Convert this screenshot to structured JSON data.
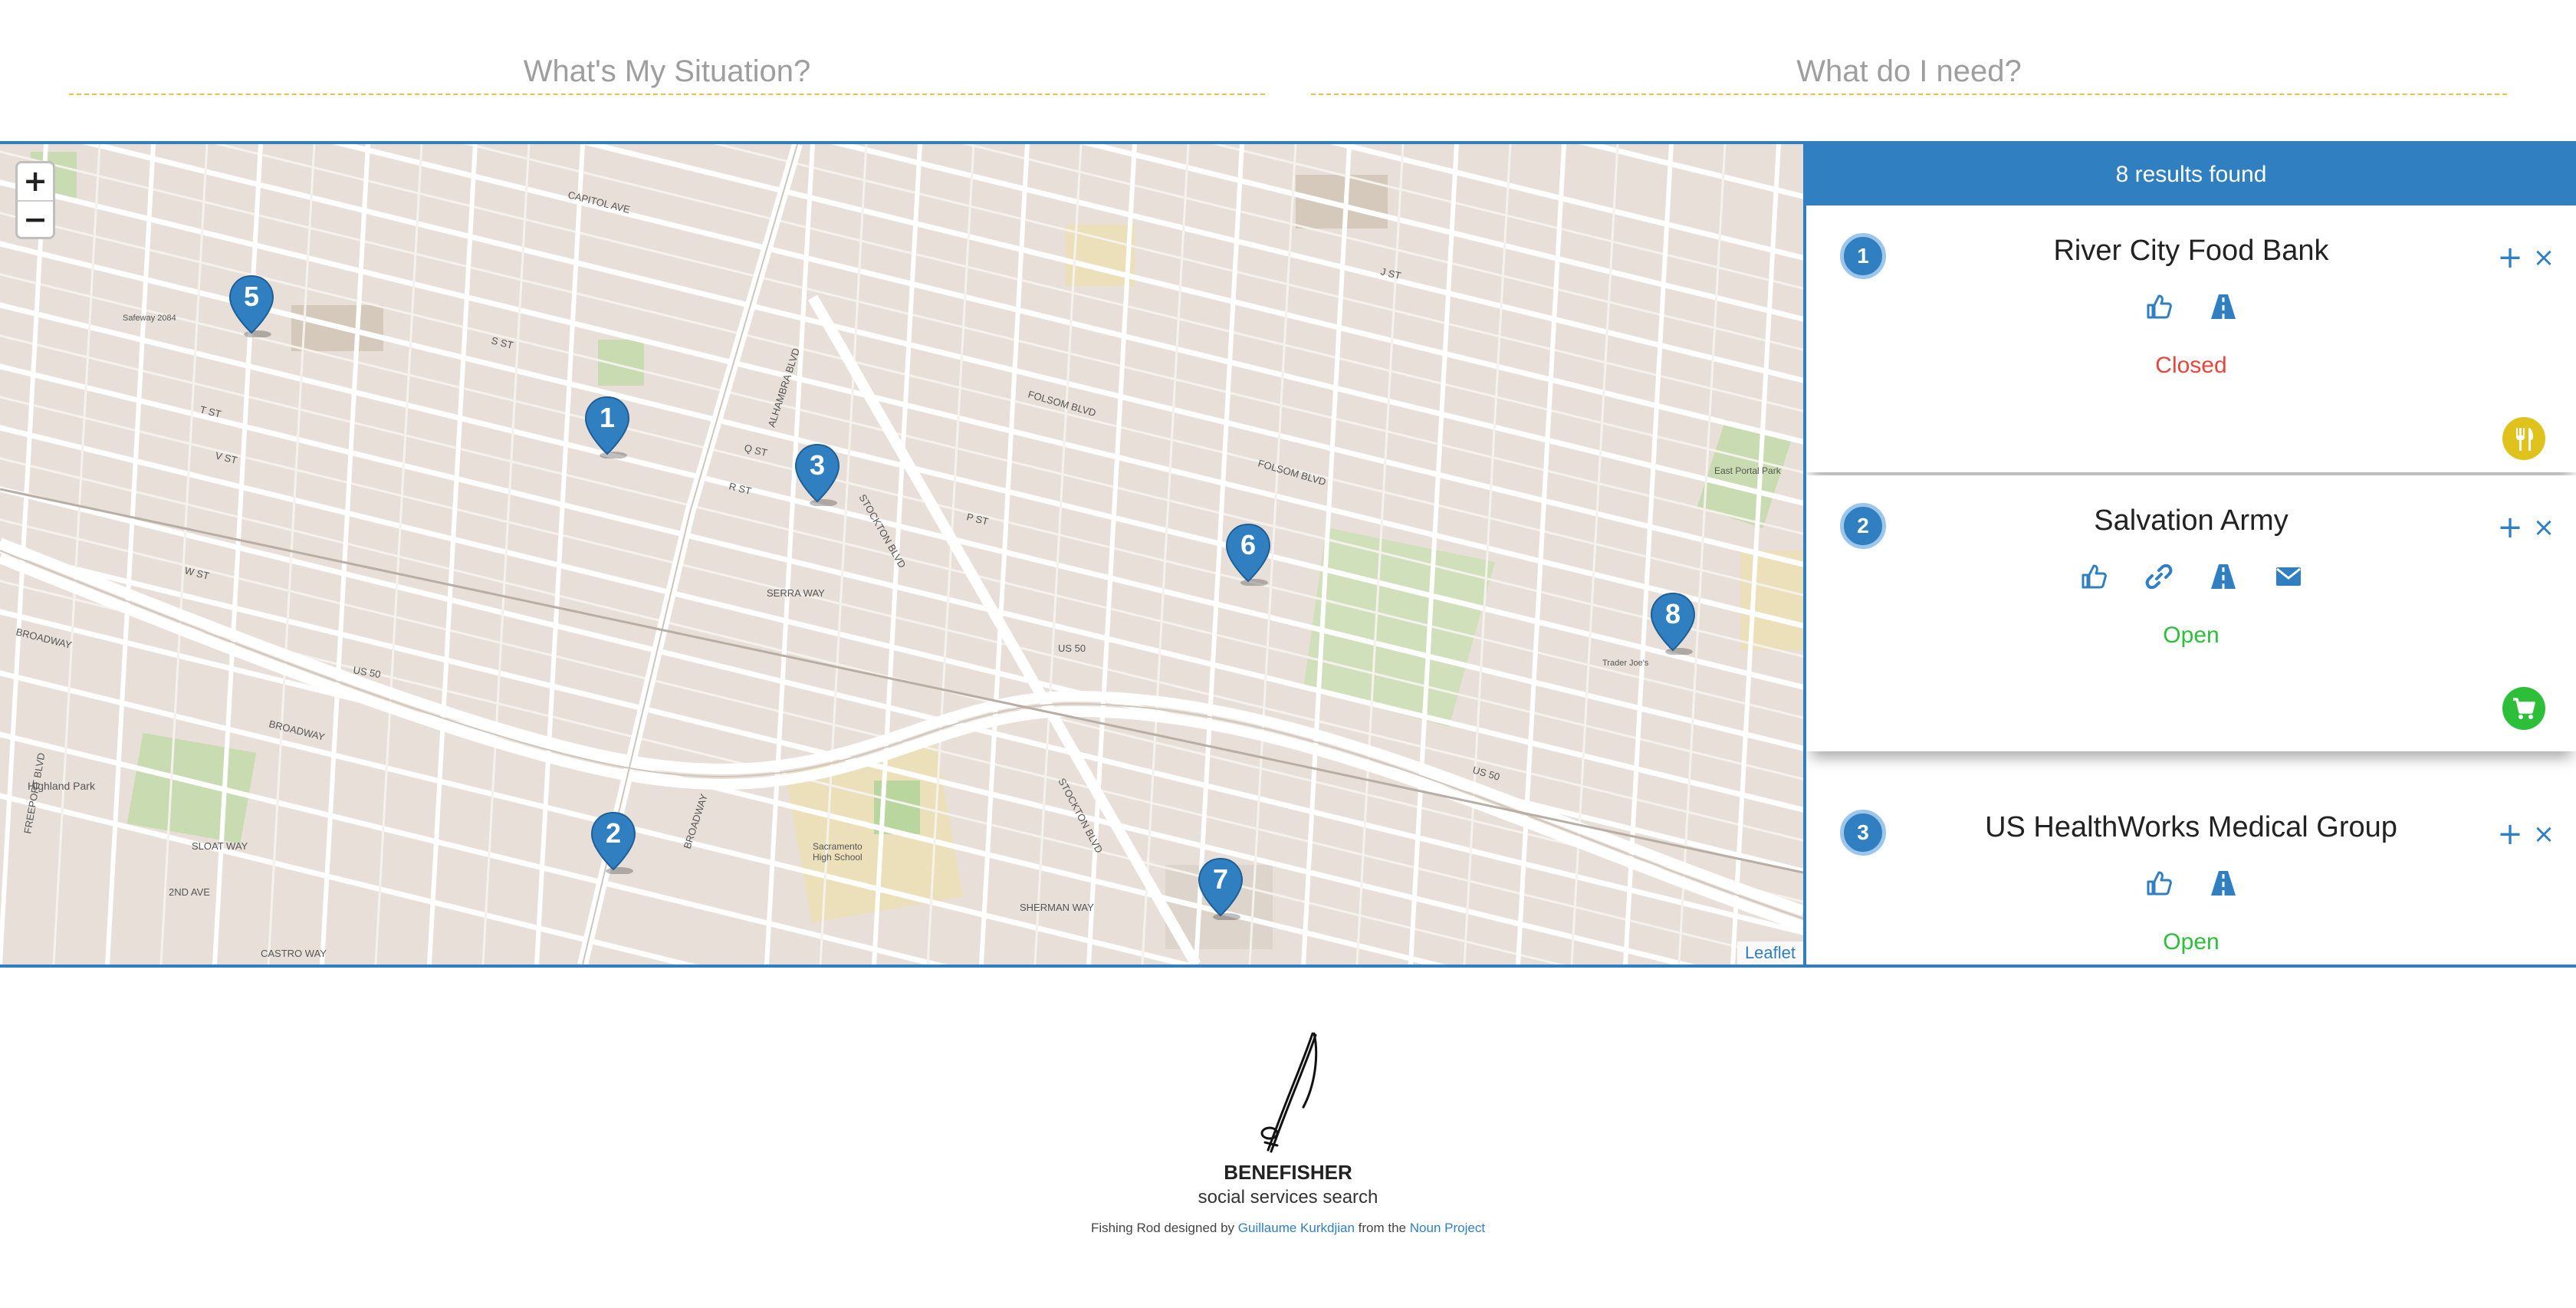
{
  "header": {
    "situation_label": "What's My Situation?",
    "need_label": "What do I need?"
  },
  "map": {
    "zoom_in_label": "+",
    "zoom_out_label": "−",
    "attribution": "Leaflet",
    "markers": [
      "1",
      "2",
      "3",
      "5",
      "6",
      "7",
      "8"
    ],
    "marker_color": "#2f7fc1",
    "street_labels": [
      "CAPITOL AVE",
      "FOLSOM BLVD",
      "STOCKTON BLVD",
      "BROADWAY",
      "US 50",
      "ALHAMBRA BLVD",
      "S ST",
      "T ST",
      "V ST",
      "W ST",
      "J ST",
      "P ST",
      "Q ST",
      "R ST",
      "SERRA WAY",
      "SHERMAN WAY",
      "2ND AVE",
      "SLOAT WAY",
      "CASTRO WAY",
      "FREEPORT BLVD",
      "Highland Park",
      "East Portal Park",
      "Sacramento High School",
      "Safeway 2084",
      "Trader Joe's"
    ]
  },
  "results": {
    "header": "8 results found",
    "header_color": "#2f7fc1",
    "items": [
      {
        "number": "1",
        "name": "River City Food Bank",
        "status": "Closed",
        "status_color": "#e8453c",
        "action_icons": [
          "thumbs-up-icon",
          "road-icon"
        ],
        "category_icon": "utensils-icon",
        "category_color": "#e0c21c"
      },
      {
        "number": "2",
        "name": "Salvation Army",
        "status": "Open",
        "status_color": "#2dbf3a",
        "action_icons": [
          "thumbs-up-icon",
          "link-icon",
          "road-icon",
          "envelope-icon"
        ],
        "category_icon": "shopping-cart-icon",
        "category_color": "#2dbf3a"
      },
      {
        "number": "3",
        "name": "US HealthWorks Medical Group",
        "status": "Open",
        "status_color": "#2dbf3a",
        "action_icons": [
          "thumbs-up-icon",
          "road-icon"
        ]
      }
    ],
    "add_label": "+",
    "remove_label": "×"
  },
  "footer": {
    "brand": "BENEFISHER",
    "tagline": "social services search",
    "credit_prefix": "Fishing Rod designed by",
    "designer": "Guillaume Kurkdjian",
    "credit_middle": "from the",
    "project": "Noun Project",
    "logo_icon": "fishing-rod-icon"
  }
}
